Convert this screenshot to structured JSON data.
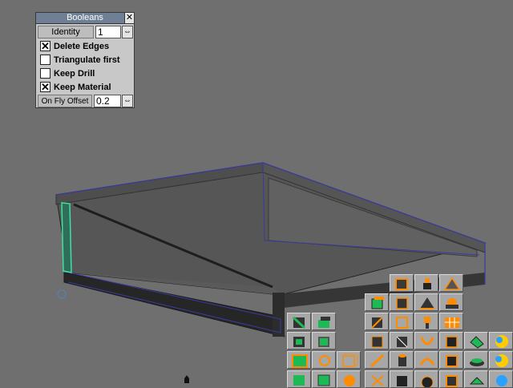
{
  "booleans_panel": {
    "title": "Booleans",
    "close_label": "✕",
    "identity_label": "Identity",
    "identity_value": "1",
    "options": [
      {
        "label": "Delete Edges",
        "checked": true
      },
      {
        "label": "Triangulate first",
        "checked": false
      },
      {
        "label": "Keep Drill",
        "checked": false
      },
      {
        "label": "Keep Material",
        "checked": true
      }
    ],
    "offset_label": "On Fly Offset",
    "offset_value": "0.2",
    "spin_glyph": "⇔"
  },
  "colors": {
    "viewport_bg": "#6f6f6f",
    "object_face": "#5e5e5e",
    "edge_blue": "#3a3aa0",
    "selection_green": "#40e0a0",
    "icon_orange": "#ff8c00",
    "icon_green": "#1db954"
  },
  "tool_palette": {
    "icons": [
      "bevel-cube-icon",
      "lathe-icon",
      "lattice-icon",
      "green-cube-icon",
      "cone-icon",
      "pyramid-icon",
      "deform-icon",
      "cube-cut-icon",
      "sweep-icon",
      "smooth-icon",
      "torus-icon",
      "grid-icon",
      "split-cube-icon",
      "extrude-icon",
      "drill-icon",
      "boolean-icon",
      "knife-icon",
      "magnet-icon",
      "sphere-icon"
    ]
  }
}
